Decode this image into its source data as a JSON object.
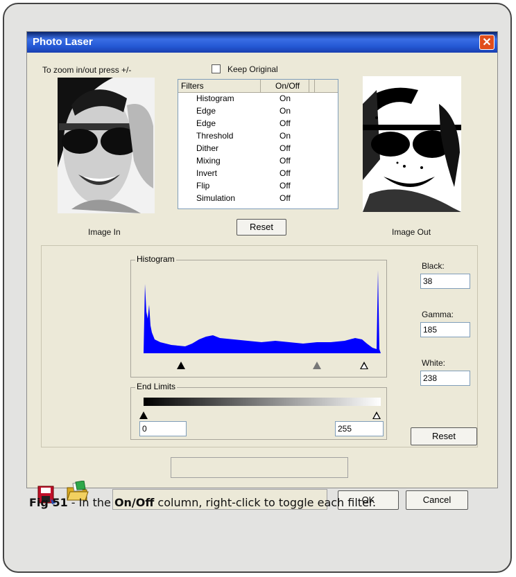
{
  "window": {
    "title": "Photo Laser"
  },
  "top": {
    "zoom_hint": "To zoom in/out press +/-",
    "keep_original": "Keep Original",
    "keep_original_checked": false,
    "image_in_label": "Image In",
    "image_out_label": "Image Out"
  },
  "filters": {
    "headers": [
      "Filters",
      "On/Off"
    ],
    "rows": [
      {
        "name": "Histogram",
        "state": "On"
      },
      {
        "name": "Edge",
        "state": "On"
      },
      {
        "name": "Edge",
        "state": "Off"
      },
      {
        "name": "Threshold",
        "state": "On"
      },
      {
        "name": "Dither",
        "state": "Off"
      },
      {
        "name": "Mixing",
        "state": "Off"
      },
      {
        "name": "Invert",
        "state": "Off"
      },
      {
        "name": "Flip",
        "state": "Off"
      },
      {
        "name": "Simulation",
        "state": "Off"
      }
    ],
    "reset_label": "Reset"
  },
  "histogram": {
    "label": "Histogram",
    "bar_color": "#0000ff"
  },
  "levels": {
    "black_label": "Black:",
    "black_value": "38",
    "gamma_label": "Gamma:",
    "gamma_value": "185",
    "white_label": "White:",
    "white_value": "238",
    "reset_label": "Reset"
  },
  "end_limits": {
    "label": "End Limits",
    "min_value": "0",
    "max_value": "255"
  },
  "footer": {
    "ok_label": "OK",
    "cancel_label": "Cancel",
    "save_icon": "floppy-disk-icon",
    "open_icon": "open-folder-icon"
  },
  "caption": {
    "fig": "Fig 51",
    "text1": " - In the ",
    "bold": "On/Off",
    "text2": " column, right-click to toggle each filter."
  }
}
